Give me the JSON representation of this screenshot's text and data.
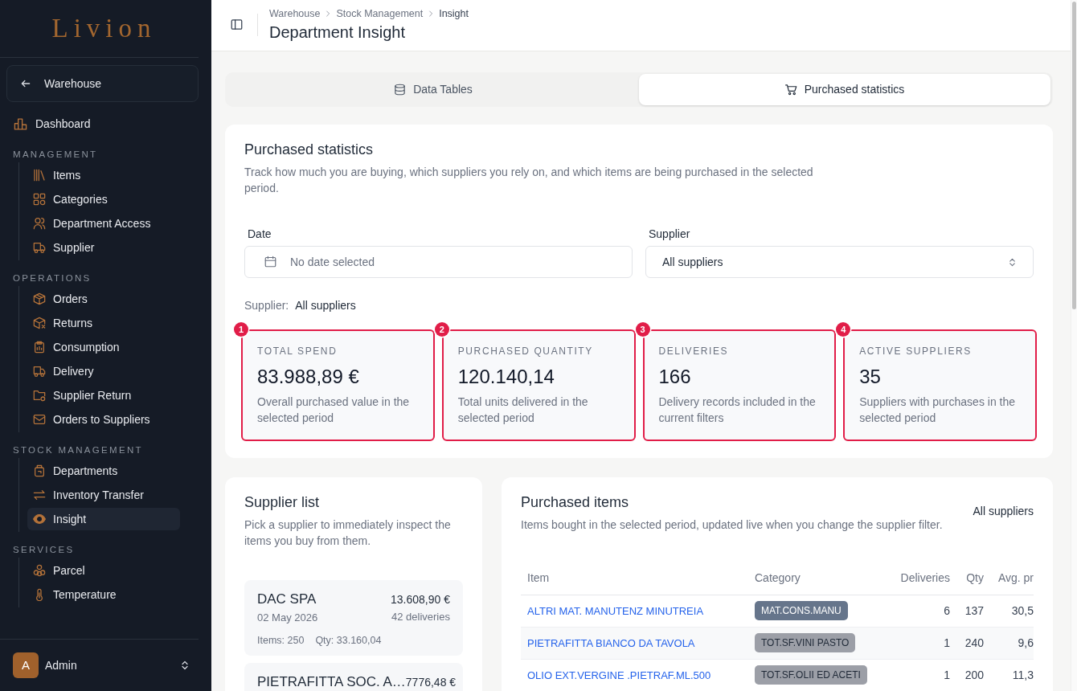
{
  "sidebar": {
    "logo": "Livion",
    "back_button": "Warehouse",
    "items": [
      {
        "label": "Dashboard",
        "selected": false
      }
    ],
    "sections": [
      {
        "title": "MANAGEMENT",
        "items": [
          {
            "label": "Items",
            "selected": false
          },
          {
            "label": "Categories",
            "selected": false
          },
          {
            "label": "Department Access",
            "selected": false
          },
          {
            "label": "Supplier",
            "selected": false
          }
        ]
      },
      {
        "title": "OPERATIONS",
        "items": [
          {
            "label": "Orders",
            "selected": false
          },
          {
            "label": "Returns",
            "selected": false
          },
          {
            "label": "Consumption",
            "selected": false
          },
          {
            "label": "Delivery",
            "selected": false
          },
          {
            "label": "Supplier Return",
            "selected": false
          },
          {
            "label": "Orders to Suppliers",
            "selected": false
          }
        ]
      },
      {
        "title": "STOCK MANAGEMENT",
        "items": [
          {
            "label": "Departments",
            "selected": false
          },
          {
            "label": "Inventory Transfer",
            "selected": false
          },
          {
            "label": "Insight",
            "selected": true
          }
        ]
      },
      {
        "title": "SERVICES",
        "items": [
          {
            "label": "Parcel",
            "selected": false
          },
          {
            "label": "Temperature",
            "selected": false
          }
        ]
      }
    ],
    "user": {
      "initial": "A",
      "name": "Admin"
    }
  },
  "header": {
    "breadcrumb": [
      "Warehouse",
      "Stock Management",
      "Insight"
    ],
    "title": "Department Insight"
  },
  "tabs": [
    {
      "label": "Data Tables",
      "selected": false
    },
    {
      "label": "Purchased statistics",
      "selected": true
    }
  ],
  "statistics": {
    "title": "Purchased statistics",
    "description": "Track how much you are buying, which suppliers you rely on, and which items are being purchased in the selected period.",
    "filters": {
      "date": {
        "label": "Date",
        "placeholder": "No date selected"
      },
      "supplier": {
        "label": "Supplier",
        "value": "All suppliers"
      }
    },
    "active_filter": {
      "label": "Supplier:",
      "value": "All suppliers"
    },
    "cards": [
      {
        "marker": "1",
        "highlighted": true,
        "label": "TOTAL SPEND",
        "value": "83.988,89 €",
        "description": "Overall purchased value in the selected period"
      },
      {
        "marker": "2",
        "highlighted": true,
        "label": "PURCHASED QUANTITY",
        "value": "120.140,14",
        "description": "Total units delivered in the selected period"
      },
      {
        "marker": "3",
        "highlighted": true,
        "label": "DELIVERIES",
        "value": "166",
        "description": "Delivery records included in the current filters"
      },
      {
        "marker": "4",
        "highlighted": true,
        "label": "ACTIVE SUPPLIERS",
        "value": "35",
        "description": "Suppliers with purchases in the selected period"
      }
    ]
  },
  "supplier_list": {
    "title": "Supplier list",
    "description": "Pick a supplier to immediately inspect the items you buy from them.",
    "suppliers": [
      {
        "name": "DAC SPA",
        "date": "02 May 2026",
        "total": "13.608,90 €",
        "deliveries": "42 deliveries",
        "items": "Items: 250",
        "qty": "Qty: 33.160,04"
      },
      {
        "name": "PIETRAFITTA SOC. A…",
        "total": "7776,48 €"
      }
    ]
  },
  "purchased_items": {
    "title": "Purchased items",
    "description": "Items bought in the selected period, updated live when you change the supplier filter.",
    "filter": "All suppliers",
    "table": {
      "columns": [
        "Item",
        "Category",
        "Deliveries",
        "Qty",
        "Avg. pr"
      ],
      "rows": [
        {
          "item": "ALTRI MAT. MANUTENZ MINUTREIA",
          "category": "MAT.CONS.MANU",
          "color": "#66758b",
          "deliveries": "6",
          "qty": "137",
          "avg_price": "30,5"
        },
        {
          "item": "PIETRAFITTA BIANCO DA TAVOLA",
          "category": "TOT.SF.VINI PASTO",
          "color": "#9c9fa7",
          "deliveries": "1",
          "qty": "240",
          "avg_price": "9,6"
        },
        {
          "item": "OLIO EXT.VERGINE .PIETRAF.ML.500",
          "category": "TOT.SF.OLII ED ACETI",
          "color": "#9c9fa7",
          "deliveries": "1",
          "qty": "200",
          "avg_price": "11,3"
        }
      ]
    }
  }
}
